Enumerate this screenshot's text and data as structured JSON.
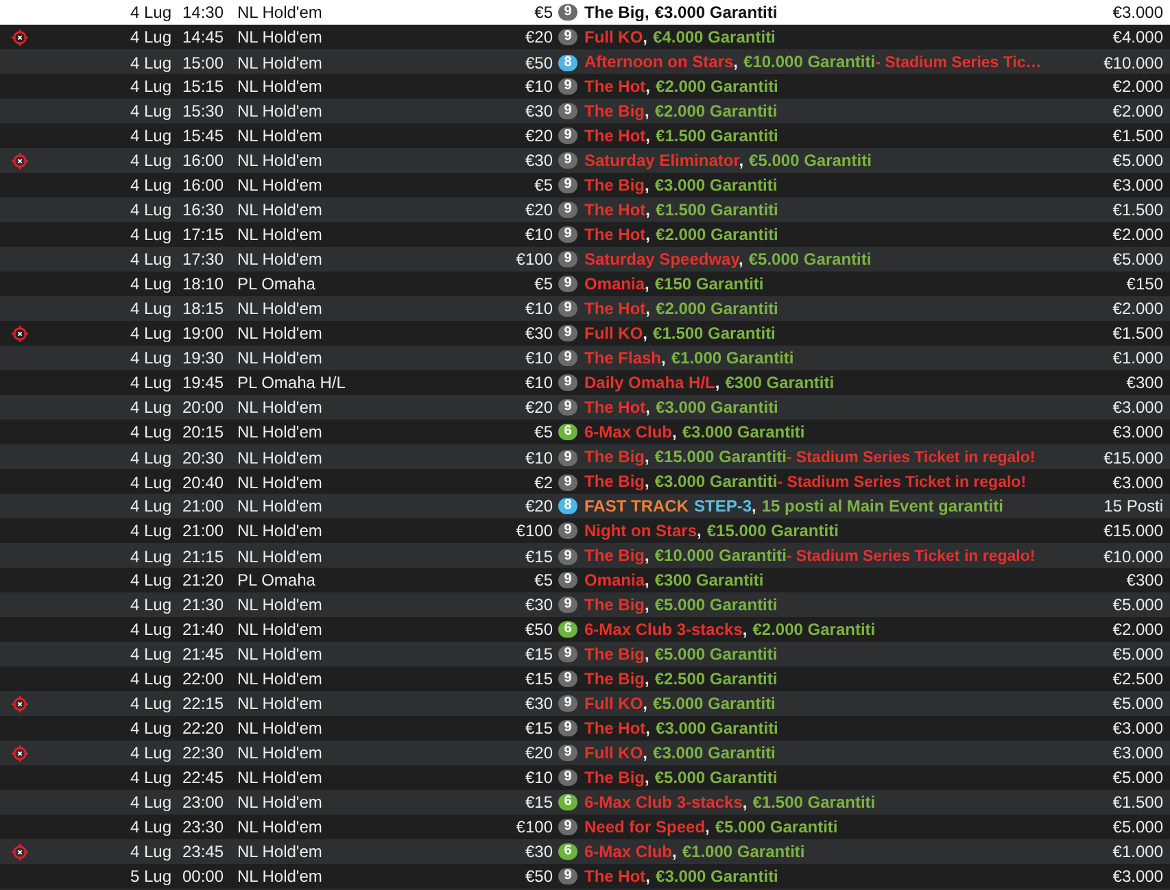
{
  "rows": [
    {
      "bounty": false,
      "selected": true,
      "date": "4 Lug",
      "time": "14:30",
      "game": "NL Hold'em",
      "buyin": "€5",
      "seats": "9",
      "color": "#6b6b6b",
      "name": [
        {
          "kind": "title",
          "text": "The Big"
        },
        {
          "kind": "sep",
          "text": ","
        },
        {
          "kind": "prize",
          "text": "€3.000 Garantiti"
        }
      ],
      "prize": "€3.000"
    },
    {
      "bounty": true,
      "selected": false,
      "date": "4 Lug",
      "time": "14:45",
      "game": "NL Hold'em",
      "buyin": "€20",
      "seats": "9",
      "color": "#6b6b6b",
      "name": [
        {
          "kind": "title",
          "text": "Full KO"
        },
        {
          "kind": "sep",
          "text": ","
        },
        {
          "kind": "prize",
          "text": "€4.000 Garantiti"
        }
      ],
      "prize": "€4.000"
    },
    {
      "bounty": false,
      "selected": false,
      "date": "4 Lug",
      "time": "15:00",
      "game": "NL Hold'em",
      "buyin": "€50",
      "seats": "8",
      "color": "#4fb5e6",
      "name": [
        {
          "kind": "title",
          "text": "Afternoon on Stars"
        },
        {
          "kind": "sep",
          "text": ","
        },
        {
          "kind": "prize",
          "text": "€10.000 Garantiti"
        },
        {
          "kind": "extra",
          "text": "- Stadium Series Tic…"
        }
      ],
      "prize": "€10.000"
    },
    {
      "bounty": false,
      "selected": false,
      "date": "4 Lug",
      "time": "15:15",
      "game": "NL Hold'em",
      "buyin": "€10",
      "seats": "9",
      "color": "#6b6b6b",
      "name": [
        {
          "kind": "title",
          "text": "The Hot"
        },
        {
          "kind": "sep",
          "text": ","
        },
        {
          "kind": "prize",
          "text": "€2.000 Garantiti"
        }
      ],
      "prize": "€2.000"
    },
    {
      "bounty": false,
      "selected": false,
      "date": "4 Lug",
      "time": "15:30",
      "game": "NL Hold'em",
      "buyin": "€30",
      "seats": "9",
      "color": "#6b6b6b",
      "name": [
        {
          "kind": "title",
          "text": "The Big"
        },
        {
          "kind": "sep",
          "text": ","
        },
        {
          "kind": "prize",
          "text": "€2.000 Garantiti"
        }
      ],
      "prize": "€2.000"
    },
    {
      "bounty": false,
      "selected": false,
      "date": "4 Lug",
      "time": "15:45",
      "game": "NL Hold'em",
      "buyin": "€20",
      "seats": "9",
      "color": "#6b6b6b",
      "name": [
        {
          "kind": "title",
          "text": "The Hot"
        },
        {
          "kind": "sep",
          "text": ","
        },
        {
          "kind": "prize",
          "text": "€1.500 Garantiti"
        }
      ],
      "prize": "€1.500"
    },
    {
      "bounty": true,
      "selected": false,
      "date": "4 Lug",
      "time": "16:00",
      "game": "NL Hold'em",
      "buyin": "€30",
      "seats": "9",
      "color": "#6b6b6b",
      "name": [
        {
          "kind": "title",
          "text": "Saturday Eliminator"
        },
        {
          "kind": "sep",
          "text": ","
        },
        {
          "kind": "prize",
          "text": "€5.000 Garantiti"
        }
      ],
      "prize": "€5.000"
    },
    {
      "bounty": false,
      "selected": false,
      "date": "4 Lug",
      "time": "16:00",
      "game": "NL Hold'em",
      "buyin": "€5",
      "seats": "9",
      "color": "#6b6b6b",
      "name": [
        {
          "kind": "title",
          "text": "The Big"
        },
        {
          "kind": "sep",
          "text": ","
        },
        {
          "kind": "prize",
          "text": "€3.000 Garantiti"
        }
      ],
      "prize": "€3.000"
    },
    {
      "bounty": false,
      "selected": false,
      "date": "4 Lug",
      "time": "16:30",
      "game": "NL Hold'em",
      "buyin": "€20",
      "seats": "9",
      "color": "#6b6b6b",
      "name": [
        {
          "kind": "title",
          "text": "The Hot"
        },
        {
          "kind": "sep",
          "text": ","
        },
        {
          "kind": "prize",
          "text": "€1.500 Garantiti"
        }
      ],
      "prize": "€1.500"
    },
    {
      "bounty": false,
      "selected": false,
      "date": "4 Lug",
      "time": "17:15",
      "game": "NL Hold'em",
      "buyin": "€10",
      "seats": "9",
      "color": "#6b6b6b",
      "name": [
        {
          "kind": "title",
          "text": "The Hot"
        },
        {
          "kind": "sep",
          "text": ","
        },
        {
          "kind": "prize",
          "text": "€2.000 Garantiti"
        }
      ],
      "prize": "€2.000"
    },
    {
      "bounty": false,
      "selected": false,
      "date": "4 Lug",
      "time": "17:30",
      "game": "NL Hold'em",
      "buyin": "€100",
      "seats": "9",
      "color": "#6b6b6b",
      "name": [
        {
          "kind": "title",
          "text": "Saturday Speedway"
        },
        {
          "kind": "sep",
          "text": ","
        },
        {
          "kind": "prize",
          "text": "€5.000 Garantiti"
        }
      ],
      "prize": "€5.000"
    },
    {
      "bounty": false,
      "selected": false,
      "date": "4 Lug",
      "time": "18:10",
      "game": "PL Omaha",
      "buyin": "€5",
      "seats": "9",
      "color": "#6b6b6b",
      "name": [
        {
          "kind": "title",
          "text": "Omania"
        },
        {
          "kind": "sep",
          "text": ","
        },
        {
          "kind": "prize",
          "text": "€150 Garantiti"
        }
      ],
      "prize": "€150"
    },
    {
      "bounty": false,
      "selected": false,
      "date": "4 Lug",
      "time": "18:15",
      "game": "NL Hold'em",
      "buyin": "€10",
      "seats": "9",
      "color": "#6b6b6b",
      "name": [
        {
          "kind": "title",
          "text": "The Hot"
        },
        {
          "kind": "sep",
          "text": ","
        },
        {
          "kind": "prize",
          "text": "€2.000 Garantiti"
        }
      ],
      "prize": "€2.000"
    },
    {
      "bounty": true,
      "selected": false,
      "date": "4 Lug",
      "time": "19:00",
      "game": "NL Hold'em",
      "buyin": "€30",
      "seats": "9",
      "color": "#6b6b6b",
      "name": [
        {
          "kind": "title",
          "text": "Full KO"
        },
        {
          "kind": "sep",
          "text": ","
        },
        {
          "kind": "prize",
          "text": "€1.500 Garantiti"
        }
      ],
      "prize": "€1.500"
    },
    {
      "bounty": false,
      "selected": false,
      "date": "4 Lug",
      "time": "19:30",
      "game": "NL Hold'em",
      "buyin": "€10",
      "seats": "9",
      "color": "#6b6b6b",
      "name": [
        {
          "kind": "title",
          "text": "The Flash"
        },
        {
          "kind": "sep",
          "text": ","
        },
        {
          "kind": "prize",
          "text": "€1.000 Garantiti"
        }
      ],
      "prize": "€1.000"
    },
    {
      "bounty": false,
      "selected": false,
      "date": "4 Lug",
      "time": "19:45",
      "game": "PL Omaha H/L",
      "buyin": "€10",
      "seats": "9",
      "color": "#6b6b6b",
      "name": [
        {
          "kind": "title",
          "text": "Daily Omaha H/L"
        },
        {
          "kind": "sep",
          "text": ","
        },
        {
          "kind": "prize",
          "text": "€300 Garantiti"
        }
      ],
      "prize": "€300"
    },
    {
      "bounty": false,
      "selected": false,
      "date": "4 Lug",
      "time": "20:00",
      "game": "NL Hold'em",
      "buyin": "€20",
      "seats": "9",
      "color": "#6b6b6b",
      "name": [
        {
          "kind": "title",
          "text": "The Hot"
        },
        {
          "kind": "sep",
          "text": ","
        },
        {
          "kind": "prize",
          "text": "€3.000 Garantiti"
        }
      ],
      "prize": "€3.000"
    },
    {
      "bounty": false,
      "selected": false,
      "date": "4 Lug",
      "time": "20:15",
      "game": "NL Hold'em",
      "buyin": "€5",
      "seats": "6",
      "color": "#6db33f",
      "name": [
        {
          "kind": "title",
          "text": "6-Max Club"
        },
        {
          "kind": "sep",
          "text": ","
        },
        {
          "kind": "prize",
          "text": "€3.000 Garantiti"
        }
      ],
      "prize": "€3.000"
    },
    {
      "bounty": false,
      "selected": false,
      "date": "4 Lug",
      "time": "20:30",
      "game": "NL Hold'em",
      "buyin": "€10",
      "seats": "9",
      "color": "#6b6b6b",
      "name": [
        {
          "kind": "title",
          "text": "The Big"
        },
        {
          "kind": "sep",
          "text": ","
        },
        {
          "kind": "prize",
          "text": "€15.000 Garantiti"
        },
        {
          "kind": "extra",
          "text": "- Stadium Series Ticket in regalo!"
        }
      ],
      "prize": "€15.000"
    },
    {
      "bounty": false,
      "selected": false,
      "date": "4 Lug",
      "time": "20:40",
      "game": "NL Hold'em",
      "buyin": "€2",
      "seats": "9",
      "color": "#6b6b6b",
      "name": [
        {
          "kind": "title",
          "text": "The Big"
        },
        {
          "kind": "sep",
          "text": ","
        },
        {
          "kind": "prize",
          "text": "€3.000 Garantiti"
        },
        {
          "kind": "extra",
          "text": "- Stadium Series Ticket in regalo!"
        }
      ],
      "prize": "€3.000"
    },
    {
      "bounty": false,
      "selected": false,
      "date": "4 Lug",
      "time": "21:00",
      "game": "NL Hold'em",
      "buyin": "€20",
      "seats": "8",
      "color": "#4fb5e6",
      "name": [
        {
          "kind": "track",
          "text": "FAST TRACK"
        },
        {
          "kind": "step",
          "text": "STEP-3"
        },
        {
          "kind": "sep",
          "text": ","
        },
        {
          "kind": "prize",
          "text": "15 posti al Main Event garantiti"
        }
      ],
      "prize": "15 Posti"
    },
    {
      "bounty": false,
      "selected": false,
      "date": "4 Lug",
      "time": "21:00",
      "game": "NL Hold'em",
      "buyin": "€100",
      "seats": "9",
      "color": "#6b6b6b",
      "name": [
        {
          "kind": "title",
          "text": "Night on Stars"
        },
        {
          "kind": "sep",
          "text": ","
        },
        {
          "kind": "prize",
          "text": "€15.000 Garantiti"
        }
      ],
      "prize": "€15.000"
    },
    {
      "bounty": false,
      "selected": false,
      "date": "4 Lug",
      "time": "21:15",
      "game": "NL Hold'em",
      "buyin": "€15",
      "seats": "9",
      "color": "#6b6b6b",
      "name": [
        {
          "kind": "title",
          "text": "The Big"
        },
        {
          "kind": "sep",
          "text": ","
        },
        {
          "kind": "prize",
          "text": "€10.000 Garantiti"
        },
        {
          "kind": "extra",
          "text": "- Stadium Series Ticket in regalo!"
        }
      ],
      "prize": "€10.000"
    },
    {
      "bounty": false,
      "selected": false,
      "date": "4 Lug",
      "time": "21:20",
      "game": "PL Omaha",
      "buyin": "€5",
      "seats": "9",
      "color": "#6b6b6b",
      "name": [
        {
          "kind": "title",
          "text": "Omania"
        },
        {
          "kind": "sep",
          "text": ","
        },
        {
          "kind": "prize",
          "text": "€300 Garantiti"
        }
      ],
      "prize": "€300"
    },
    {
      "bounty": false,
      "selected": false,
      "date": "4 Lug",
      "time": "21:30",
      "game": "NL Hold'em",
      "buyin": "€30",
      "seats": "9",
      "color": "#6b6b6b",
      "name": [
        {
          "kind": "title",
          "text": "The Big"
        },
        {
          "kind": "sep",
          "text": ","
        },
        {
          "kind": "prize",
          "text": "€5.000 Garantiti"
        }
      ],
      "prize": "€5.000"
    },
    {
      "bounty": false,
      "selected": false,
      "date": "4 Lug",
      "time": "21:40",
      "game": "NL Hold'em",
      "buyin": "€50",
      "seats": "6",
      "color": "#6db33f",
      "name": [
        {
          "kind": "title",
          "text": "6-Max Club 3-stacks"
        },
        {
          "kind": "sep",
          "text": ","
        },
        {
          "kind": "prize",
          "text": "€2.000 Garantiti"
        }
      ],
      "prize": "€2.000"
    },
    {
      "bounty": false,
      "selected": false,
      "date": "4 Lug",
      "time": "21:45",
      "game": "NL Hold'em",
      "buyin": "€15",
      "seats": "9",
      "color": "#6b6b6b",
      "name": [
        {
          "kind": "title",
          "text": "The Big"
        },
        {
          "kind": "sep",
          "text": ","
        },
        {
          "kind": "prize",
          "text": "€5.000 Garantiti"
        }
      ],
      "prize": "€5.000"
    },
    {
      "bounty": false,
      "selected": false,
      "date": "4 Lug",
      "time": "22:00",
      "game": "NL Hold'em",
      "buyin": "€15",
      "seats": "9",
      "color": "#6b6b6b",
      "name": [
        {
          "kind": "title",
          "text": "The Big"
        },
        {
          "kind": "sep",
          "text": ","
        },
        {
          "kind": "prize",
          "text": "€2.500 Garantiti"
        }
      ],
      "prize": "€2.500"
    },
    {
      "bounty": true,
      "selected": false,
      "date": "4 Lug",
      "time": "22:15",
      "game": "NL Hold'em",
      "buyin": "€30",
      "seats": "9",
      "color": "#6b6b6b",
      "name": [
        {
          "kind": "title",
          "text": "Full KO"
        },
        {
          "kind": "sep",
          "text": ","
        },
        {
          "kind": "prize",
          "text": "€5.000 Garantiti"
        }
      ],
      "prize": "€5.000"
    },
    {
      "bounty": false,
      "selected": false,
      "date": "4 Lug",
      "time": "22:20",
      "game": "NL Hold'em",
      "buyin": "€15",
      "seats": "9",
      "color": "#6b6b6b",
      "name": [
        {
          "kind": "title",
          "text": "The Hot"
        },
        {
          "kind": "sep",
          "text": ","
        },
        {
          "kind": "prize",
          "text": "€3.000 Garantiti"
        }
      ],
      "prize": "€3.000"
    },
    {
      "bounty": true,
      "selected": false,
      "date": "4 Lug",
      "time": "22:30",
      "game": "NL Hold'em",
      "buyin": "€20",
      "seats": "9",
      "color": "#6b6b6b",
      "name": [
        {
          "kind": "title",
          "text": "Full KO"
        },
        {
          "kind": "sep",
          "text": ","
        },
        {
          "kind": "prize",
          "text": "€3.000 Garantiti"
        }
      ],
      "prize": "€3.000"
    },
    {
      "bounty": false,
      "selected": false,
      "date": "4 Lug",
      "time": "22:45",
      "game": "NL Hold'em",
      "buyin": "€10",
      "seats": "9",
      "color": "#6b6b6b",
      "name": [
        {
          "kind": "title",
          "text": "The Big"
        },
        {
          "kind": "sep",
          "text": ","
        },
        {
          "kind": "prize",
          "text": "€5.000 Garantiti"
        }
      ],
      "prize": "€5.000"
    },
    {
      "bounty": false,
      "selected": false,
      "date": "4 Lug",
      "time": "23:00",
      "game": "NL Hold'em",
      "buyin": "€15",
      "seats": "6",
      "color": "#6db33f",
      "name": [
        {
          "kind": "title",
          "text": "6-Max Club 3-stacks"
        },
        {
          "kind": "sep",
          "text": ","
        },
        {
          "kind": "prize",
          "text": "€1.500 Garantiti"
        }
      ],
      "prize": "€1.500"
    },
    {
      "bounty": false,
      "selected": false,
      "date": "4 Lug",
      "time": "23:30",
      "game": "NL Hold'em",
      "buyin": "€100",
      "seats": "9",
      "color": "#6b6b6b",
      "name": [
        {
          "kind": "title",
          "text": "Need for Speed"
        },
        {
          "kind": "sep",
          "text": ","
        },
        {
          "kind": "prize",
          "text": "€5.000 Garantiti"
        }
      ],
      "prize": "€5.000"
    },
    {
      "bounty": true,
      "selected": false,
      "date": "4 Lug",
      "time": "23:45",
      "game": "NL Hold'em",
      "buyin": "€30",
      "seats": "6",
      "color": "#6db33f",
      "name": [
        {
          "kind": "title",
          "text": "6-Max Club"
        },
        {
          "kind": "sep",
          "text": ","
        },
        {
          "kind": "prize",
          "text": "€1.000 Garantiti"
        }
      ],
      "prize": "€1.000"
    },
    {
      "bounty": false,
      "selected": false,
      "date": "5 Lug",
      "time": "00:00",
      "game": "NL Hold'em",
      "buyin": "€50",
      "seats": "9",
      "color": "#6b6b6b",
      "name": [
        {
          "kind": "title",
          "text": "The Hot"
        },
        {
          "kind": "sep",
          "text": ","
        },
        {
          "kind": "prize",
          "text": "€3.000 Garantiti"
        }
      ],
      "prize": "€3.000"
    }
  ]
}
